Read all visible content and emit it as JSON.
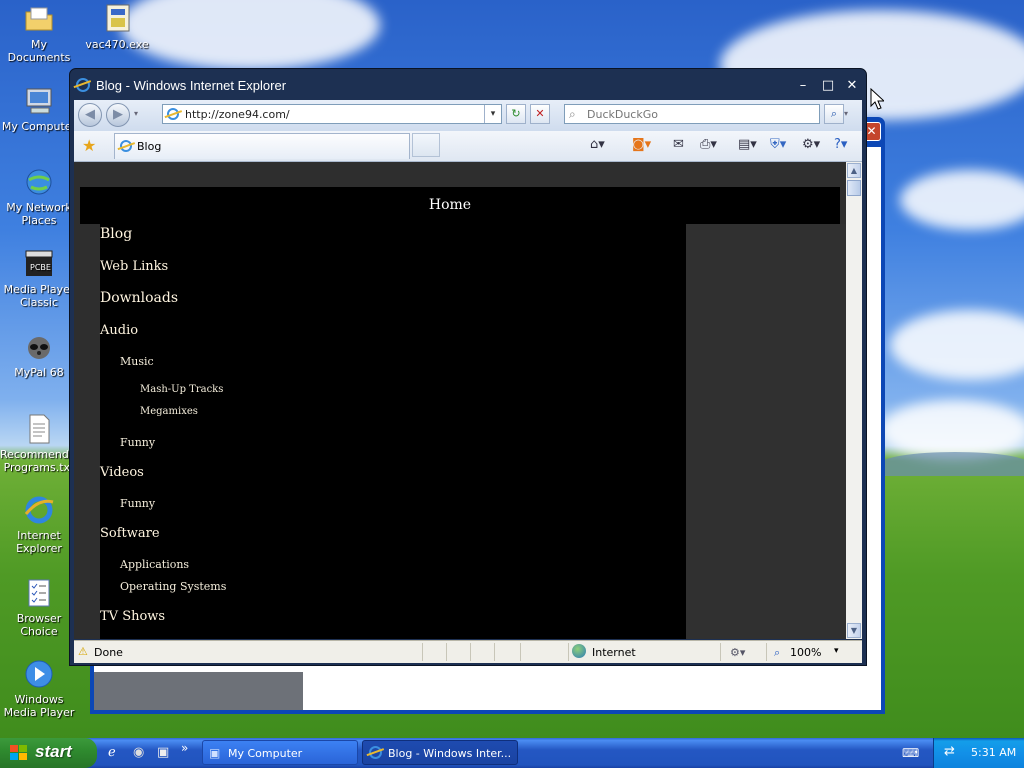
{
  "desktop": {
    "icons": [
      {
        "label": "My Documents",
        "icon": "folder-icon"
      },
      {
        "label": "vac470.exe",
        "icon": "installer-icon"
      },
      {
        "label": "My Computer",
        "icon": "computer-icon"
      },
      {
        "label": "My Network Places",
        "icon": "network-icon"
      },
      {
        "label": "Media Player Classic",
        "icon": "media-player-icon"
      },
      {
        "label": "MyPal 68",
        "icon": "mypal-icon"
      },
      {
        "label": "Recommended Programs.txt",
        "icon": "text-file-icon"
      },
      {
        "label": "Internet Explorer",
        "icon": "ie-icon"
      },
      {
        "label": "Browser Choice",
        "icon": "browser-choice-icon"
      },
      {
        "label": "Windows Media Player",
        "icon": "wmp-icon"
      }
    ]
  },
  "window": {
    "title": "Blog - Windows Internet Explorer",
    "minimize": "–",
    "maximize": "□",
    "close": "✕"
  },
  "nav": {
    "back": "◀",
    "forward": "▶",
    "address": "http://zone94.com/",
    "refresh": "↻",
    "stop": "✕",
    "search_placeholder": "DuckDuckGo",
    "search_button": "⌕"
  },
  "tab": {
    "label": "Blog"
  },
  "page": {
    "home": "Home",
    "menu": [
      {
        "label": "Blog",
        "level": 1
      },
      {
        "label": "Web Links",
        "level": 1
      },
      {
        "label": "Downloads",
        "level": 1
      },
      {
        "label": "Audio",
        "level": 1
      },
      {
        "label": "Music",
        "level": 2
      },
      {
        "label": "Mash-Up Tracks",
        "level": 3
      },
      {
        "label": "Megamixes",
        "level": 3
      },
      {
        "label": "Funny",
        "level": 2
      },
      {
        "label": "Videos",
        "level": 1
      },
      {
        "label": "Funny",
        "level": 2
      },
      {
        "label": "Software",
        "level": 1
      },
      {
        "label": "Applications",
        "level": 2
      },
      {
        "label": "Operating Systems",
        "level": 2
      },
      {
        "label": "TV Shows",
        "level": 1
      }
    ]
  },
  "status": {
    "text": "Done",
    "zone": "Internet",
    "zoom": "100%"
  },
  "taskbar": {
    "start": "start",
    "tasks": [
      {
        "label": "My Computer"
      },
      {
        "label": "Blog - Windows Inter..."
      }
    ],
    "clock": "5:31 AM",
    "more": "»"
  }
}
